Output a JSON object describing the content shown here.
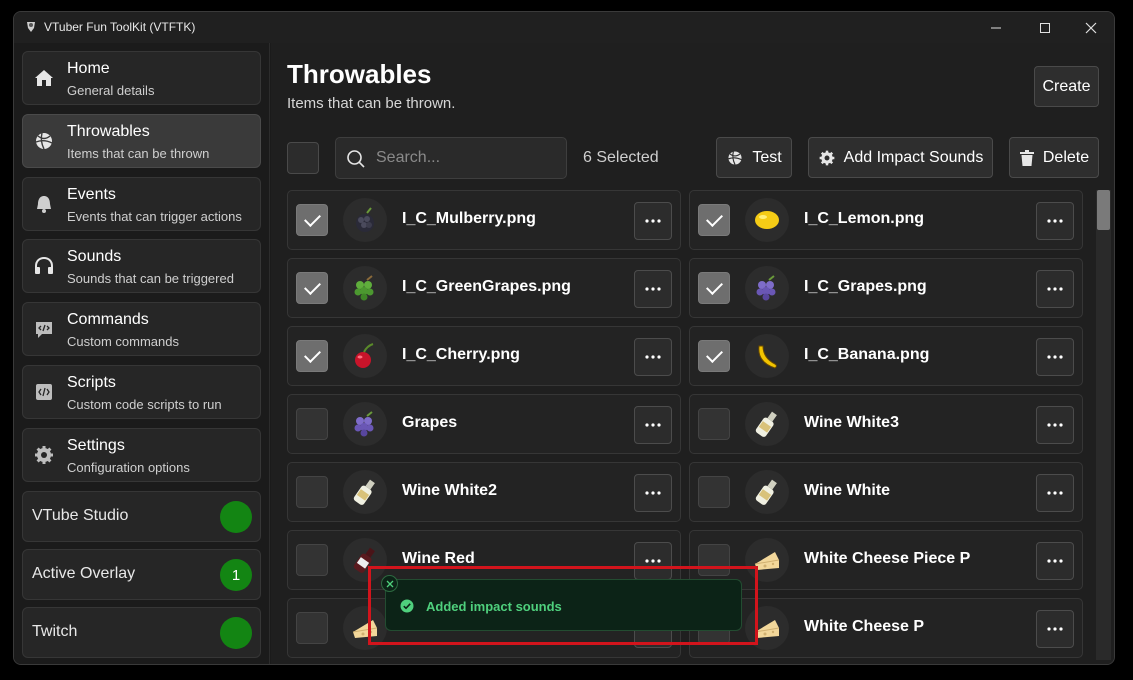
{
  "window": {
    "title": "VTuber Fun ToolKit (VTFTK)",
    "controls": [
      "minimize",
      "maximize",
      "close"
    ]
  },
  "sidebar": {
    "items": [
      {
        "title": "Home",
        "subtitle": "General details",
        "icon": "home-icon",
        "active": false
      },
      {
        "title": "Throwables",
        "subtitle": "Items that can be thrown",
        "icon": "ball-icon",
        "active": true
      },
      {
        "title": "Events",
        "subtitle": "Events that can trigger actions",
        "icon": "bell-icon",
        "active": false
      },
      {
        "title": "Sounds",
        "subtitle": "Sounds that can be triggered",
        "icon": "headphones-icon",
        "active": false
      },
      {
        "title": "Commands",
        "subtitle": "Custom commands",
        "icon": "command-icon",
        "active": false
      },
      {
        "title": "Scripts",
        "subtitle": "Custom code scripts to run",
        "icon": "code-icon",
        "active": false
      },
      {
        "title": "Settings",
        "subtitle": "Configuration options",
        "icon": "gear-icon",
        "active": false
      }
    ],
    "status": [
      {
        "label": "VTube Studio",
        "badge": "",
        "color": "#138513"
      },
      {
        "label": "Active Overlay",
        "badge": "1",
        "color": "#138513"
      },
      {
        "label": "Twitch",
        "badge": "",
        "color": "#138513"
      }
    ]
  },
  "main": {
    "title": "Throwables",
    "subtitle": "Items that can be thrown.",
    "create_label": "Create",
    "search_placeholder": "Search...",
    "selected_text": "6 Selected",
    "test_label": "Test",
    "add_sounds_label": "Add Impact Sounds",
    "delete_label": "Delete",
    "items": [
      {
        "name": "I_C_Mulberry.png",
        "checked": true,
        "icon": "mulberry-icon"
      },
      {
        "name": "I_C_Lemon.png",
        "checked": true,
        "icon": "lemon-icon"
      },
      {
        "name": "I_C_GreenGrapes.png",
        "checked": true,
        "icon": "green-grapes-icon"
      },
      {
        "name": "I_C_Grapes.png",
        "checked": true,
        "icon": "grapes-icon"
      },
      {
        "name": "I_C_Cherry.png",
        "checked": true,
        "icon": "cherry-icon"
      },
      {
        "name": "I_C_Banana.png",
        "checked": true,
        "icon": "banana-icon"
      },
      {
        "name": "Grapes",
        "checked": false,
        "icon": "grapes-icon"
      },
      {
        "name": "Wine White3",
        "checked": false,
        "icon": "wine-bottle-icon"
      },
      {
        "name": "Wine White2",
        "checked": false,
        "icon": "wine-bottle-icon"
      },
      {
        "name": "Wine White",
        "checked": false,
        "icon": "wine-bottle-icon"
      },
      {
        "name": "Wine Red",
        "checked": false,
        "icon": "red-wine-bottle-icon"
      },
      {
        "name": "White Cheese Piece P",
        "checked": false,
        "icon": "cheese-icon"
      },
      {
        "name": "",
        "checked": false,
        "icon": "cheese-icon"
      },
      {
        "name": "White Cheese P",
        "checked": false,
        "icon": "cheese-icon"
      }
    ]
  },
  "toast": {
    "message": "Added impact sounds",
    "color": "#4fd07d"
  },
  "highlight_color": "#d2141c"
}
